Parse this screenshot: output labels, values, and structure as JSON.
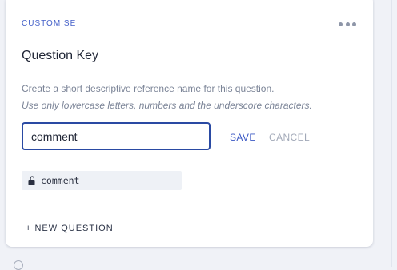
{
  "panel": {
    "section_label": "CUSTOMISE",
    "more_icon": "more-horizontal-icon",
    "title": "Question Key",
    "description_line1": "Create a short descriptive reference name for this question.",
    "description_line2": "Use only lowercase letters, numbers and the underscore characters.",
    "input_value": "comment",
    "save_label": "SAVE",
    "cancel_label": "CANCEL",
    "key_icon": "lock-icon",
    "current_key": "comment"
  },
  "footer": {
    "new_question_label": "+ NEW QUESTION"
  },
  "colors": {
    "accent": "#3b58c4",
    "input_border": "#2a4aa3",
    "muted_text": "#7b8497",
    "background": "#f0f2f7"
  }
}
